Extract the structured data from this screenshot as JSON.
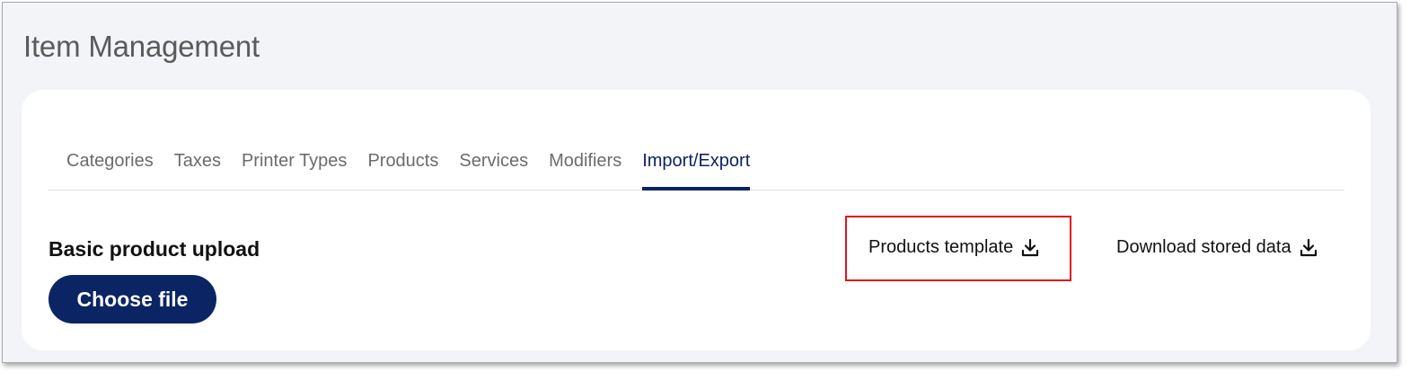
{
  "page": {
    "title": "Item Management"
  },
  "tabs": [
    {
      "label": "Categories",
      "active": false
    },
    {
      "label": "Taxes",
      "active": false
    },
    {
      "label": "Printer Types",
      "active": false
    },
    {
      "label": "Products",
      "active": false
    },
    {
      "label": "Services",
      "active": false
    },
    {
      "label": "Modifiers",
      "active": false
    },
    {
      "label": "Import/Export",
      "active": true
    }
  ],
  "upload": {
    "section_title": "Basic product upload",
    "choose_file_label": "Choose file"
  },
  "downloads": {
    "template_label": "Products template",
    "template_icon": "download-icon",
    "stored_label": "Download stored data",
    "stored_icon": "download-icon"
  },
  "colors": {
    "brand_navy": "#0b2463",
    "highlight_red": "#e0141b",
    "background": "#f3f4f7"
  }
}
